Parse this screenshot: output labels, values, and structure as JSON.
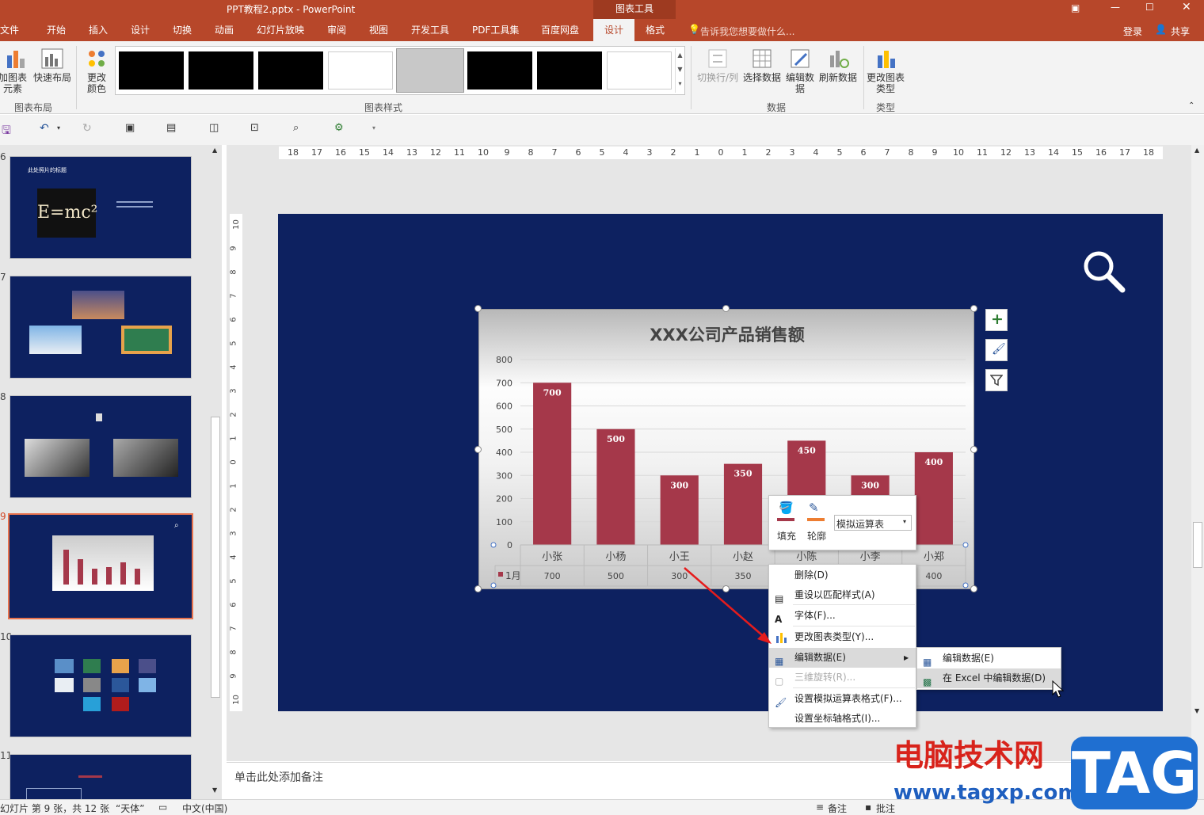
{
  "window": {
    "title": "PPT教程2.pptx - PowerPoint",
    "chart_tools": "图表工具"
  },
  "tabs": [
    "文件",
    "开始",
    "插入",
    "设计",
    "切换",
    "动画",
    "幻灯片放映",
    "审阅",
    "视图",
    "开发工具",
    "PDF工具集",
    "百度网盘",
    "设计",
    "格式"
  ],
  "search_hint": "告诉我您想要做什么...",
  "account": {
    "login": "登录",
    "share": "共享"
  },
  "ribbon": {
    "layout_group": {
      "add_element": "加图表元素",
      "quick_layout": "快速布局",
      "label": "图表布局"
    },
    "change_color": "更改颜色",
    "styles_label": "图表样式",
    "data_group": {
      "switch": "切换行/列",
      "select": "选择数据",
      "edit": "编辑数据",
      "refresh": "刷新数据",
      "label": "数据"
    },
    "type_group": {
      "change_type": "更改图表类型",
      "label": "类型"
    }
  },
  "thumbnails": [
    {
      "num": "6",
      "title": "此处照片的标题",
      "formula": "E=mc²"
    },
    {
      "num": "7"
    },
    {
      "num": "8"
    },
    {
      "num": "9"
    },
    {
      "num": "10"
    },
    {
      "num": "11"
    }
  ],
  "chart_data": {
    "type": "bar",
    "title": "XXX公司产品销售额",
    "categories": [
      "小张",
      "小杨",
      "小王",
      "小赵",
      "小陈",
      "小李",
      "小郑"
    ],
    "series": [
      {
        "name": "1月",
        "values": [
          700,
          500,
          300,
          350,
          450,
          300,
          400
        ]
      }
    ],
    "yticks": [
      "0",
      "100",
      "200",
      "300",
      "400",
      "500",
      "600",
      "700",
      "800"
    ],
    "ylim": [
      0,
      800
    ],
    "table_values": [
      "700",
      "500",
      "300",
      "350",
      "",
      "",
      "400"
    ],
    "bar_color": "#a5384a",
    "grid": true
  },
  "minibar": {
    "fill": "填充",
    "outline": "轮廓",
    "dropdown": "模拟运算表"
  },
  "context_menu": [
    "删除(D)",
    "重设以匹配样式(A)",
    "字体(F)...",
    "更改图表类型(Y)...",
    "编辑数据(E)",
    "三维旋转(R)...",
    "设置模拟运算表格式(F)...",
    "设置坐标轴格式(I)..."
  ],
  "submenu": [
    "编辑数据(E)",
    "在 Excel 中编辑数据(D)"
  ],
  "notes_placeholder": "单击此处添加备注",
  "status": {
    "slide": "幻灯片 第 9 张，共 12 张",
    "theme": "“天体”",
    "lang": "中文(中国)",
    "notes": "备注",
    "comments": "批注"
  },
  "watermark": {
    "site": "电脑技术网",
    "url": "www.tagxp.com",
    "tag": "TAG"
  }
}
